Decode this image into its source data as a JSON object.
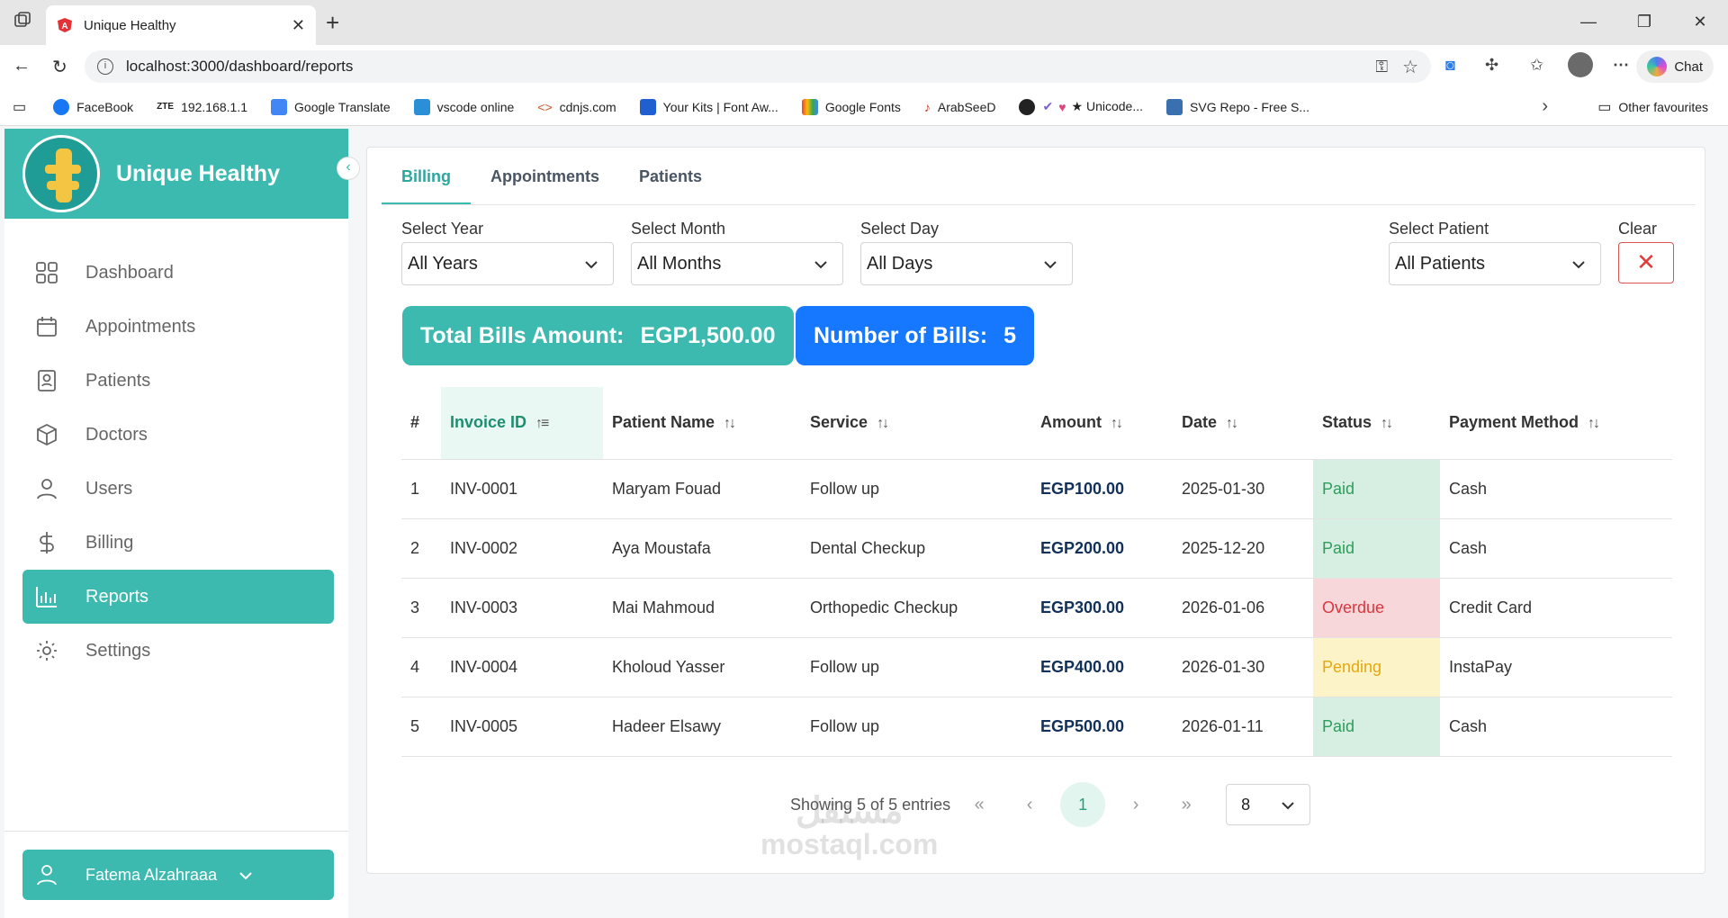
{
  "browser": {
    "tab_title": "Unique Healthy",
    "url": "localhost:3000/dashboard/reports",
    "chat_label": "Chat",
    "bookmarks": [
      "FaceBook",
      "192.168.1.1",
      "Google Translate",
      "vscode online",
      "cdnjs.com",
      "Your Kits | Font Aw...",
      "Google Fonts",
      "ArabSeeD",
      "★ Unicode...",
      "SVG Repo - Free S..."
    ],
    "other_favourites": "Other favourites",
    "zte_label": "ZTE"
  },
  "sidebar": {
    "brand": "Unique Healthy",
    "items": [
      {
        "label": "Dashboard",
        "icon": "grid-icon"
      },
      {
        "label": "Appointments",
        "icon": "calendar-icon"
      },
      {
        "label": "Patients",
        "icon": "patient-card-icon"
      },
      {
        "label": "Doctors",
        "icon": "cube-icon"
      },
      {
        "label": "Users",
        "icon": "user-icon"
      },
      {
        "label": "Billing",
        "icon": "dollar-icon"
      },
      {
        "label": "Reports",
        "icon": "chart-icon",
        "active": true
      },
      {
        "label": "Settings",
        "icon": "gear-icon"
      }
    ],
    "user": "Fatema Alzahraaa"
  },
  "tabs": [
    "Billing",
    "Appointments",
    "Patients"
  ],
  "filters": {
    "year_label": "Select Year",
    "year_value": "All Years",
    "month_label": "Select Month",
    "month_value": "All Months",
    "day_label": "Select Day",
    "day_value": "All Days",
    "patient_label": "Select Patient",
    "patient_value": "All Patients",
    "clear_label": "Clear"
  },
  "stats": {
    "total_label": "Total Bills Amount:",
    "total_value": "EGP1,500.00",
    "count_label": "Number of Bills:",
    "count_value": "5"
  },
  "table": {
    "headers": [
      "#",
      "Invoice ID",
      "Patient Name",
      "Service",
      "Amount",
      "Date",
      "Status",
      "Payment Method"
    ],
    "rows": [
      [
        "1",
        "INV-0001",
        "Maryam Fouad",
        "Follow up",
        "EGP100.00",
        "2025-01-30",
        "Paid",
        "Cash"
      ],
      [
        "2",
        "INV-0002",
        "Aya Moustafa",
        "Dental Checkup",
        "EGP200.00",
        "2025-12-20",
        "Paid",
        "Cash"
      ],
      [
        "3",
        "INV-0003",
        "Mai Mahmoud",
        "Orthopedic Checkup",
        "EGP300.00",
        "2026-01-06",
        "Overdue",
        "Credit Card"
      ],
      [
        "4",
        "INV-0004",
        "Kholoud Yasser",
        "Follow up",
        "EGP400.00",
        "2026-01-30",
        "Pending",
        "InstaPay"
      ],
      [
        "5",
        "INV-0005",
        "Hadeer Elsawy",
        "Follow up",
        "EGP500.00",
        "2026-01-11",
        "Paid",
        "Cash"
      ]
    ]
  },
  "pager": {
    "showing": "Showing 5 of 5 entries",
    "current_page": "1",
    "page_size": "8"
  },
  "watermark": {
    "line1": "مستقل",
    "line2": "mostaql.com"
  },
  "colors": {
    "accent": "#3cbab0",
    "stat_blue": "#1677ff",
    "paid": "#2e9d5a",
    "overdue": "#d9363e",
    "pending": "#e5a80e"
  }
}
